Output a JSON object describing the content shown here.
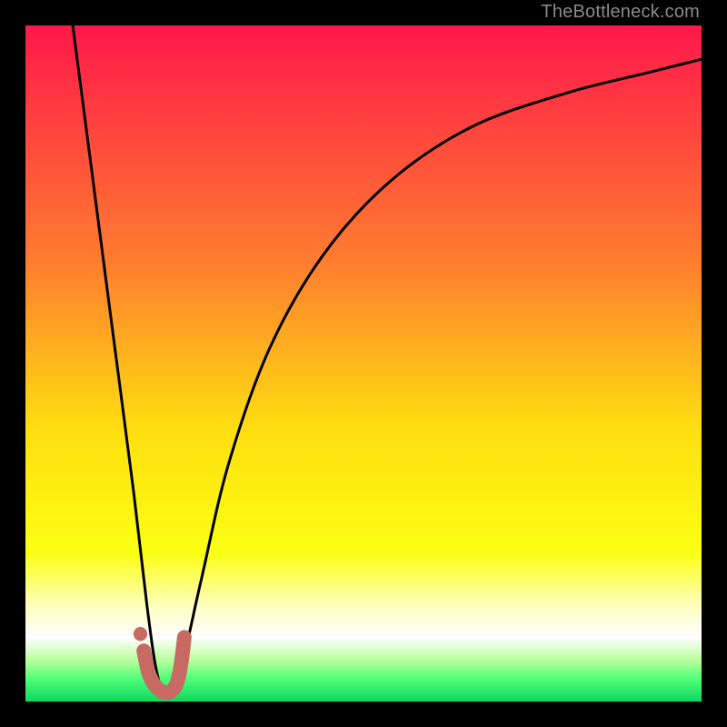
{
  "watermark": {
    "text": "TheBottleneck.com"
  },
  "colors": {
    "frame": "#000000",
    "curve": "#000000",
    "marker": "#c66a63",
    "gradient_stops": [
      {
        "offset": 0.0,
        "color": "#ff184a"
      },
      {
        "offset": 0.35,
        "color": "#ff7d2f"
      },
      {
        "offset": 0.6,
        "color": "#ffdf10"
      },
      {
        "offset": 0.78,
        "color": "#fbff12"
      },
      {
        "offset": 0.86,
        "color": "#ffffc2"
      },
      {
        "offset": 0.905,
        "color": "#ffffff"
      },
      {
        "offset": 0.94,
        "color": "#b6ff9a"
      },
      {
        "offset": 0.965,
        "color": "#54ff79"
      },
      {
        "offset": 1.0,
        "color": "#0cd85f"
      }
    ]
  },
  "chart_data": {
    "type": "line",
    "title": "",
    "xlabel": "",
    "ylabel": "",
    "xlim": [
      0,
      100
    ],
    "ylim": [
      0,
      100
    ],
    "series": [
      {
        "name": "bottleneck-curve",
        "x": [
          7,
          10,
          13,
          16,
          18,
          19.5,
          21,
          23,
          26,
          30,
          36,
          44,
          54,
          66,
          80,
          92,
          100
        ],
        "y": [
          100,
          77,
          54,
          31,
          14,
          4,
          1,
          5,
          18,
          35,
          52,
          66,
          77,
          85,
          90,
          93,
          95
        ]
      }
    ],
    "marker": {
      "name": "j-marker",
      "stroke_width_px": 16,
      "points_xy": [
        [
          17.5,
          7.5
        ],
        [
          18.3,
          4.0
        ],
        [
          19.5,
          2.0
        ],
        [
          21.0,
          1.3
        ],
        [
          22.3,
          2.5
        ],
        [
          23.0,
          5.5
        ],
        [
          23.5,
          9.5
        ]
      ],
      "dot_xy": [
        17.0,
        10.0
      ]
    }
  }
}
